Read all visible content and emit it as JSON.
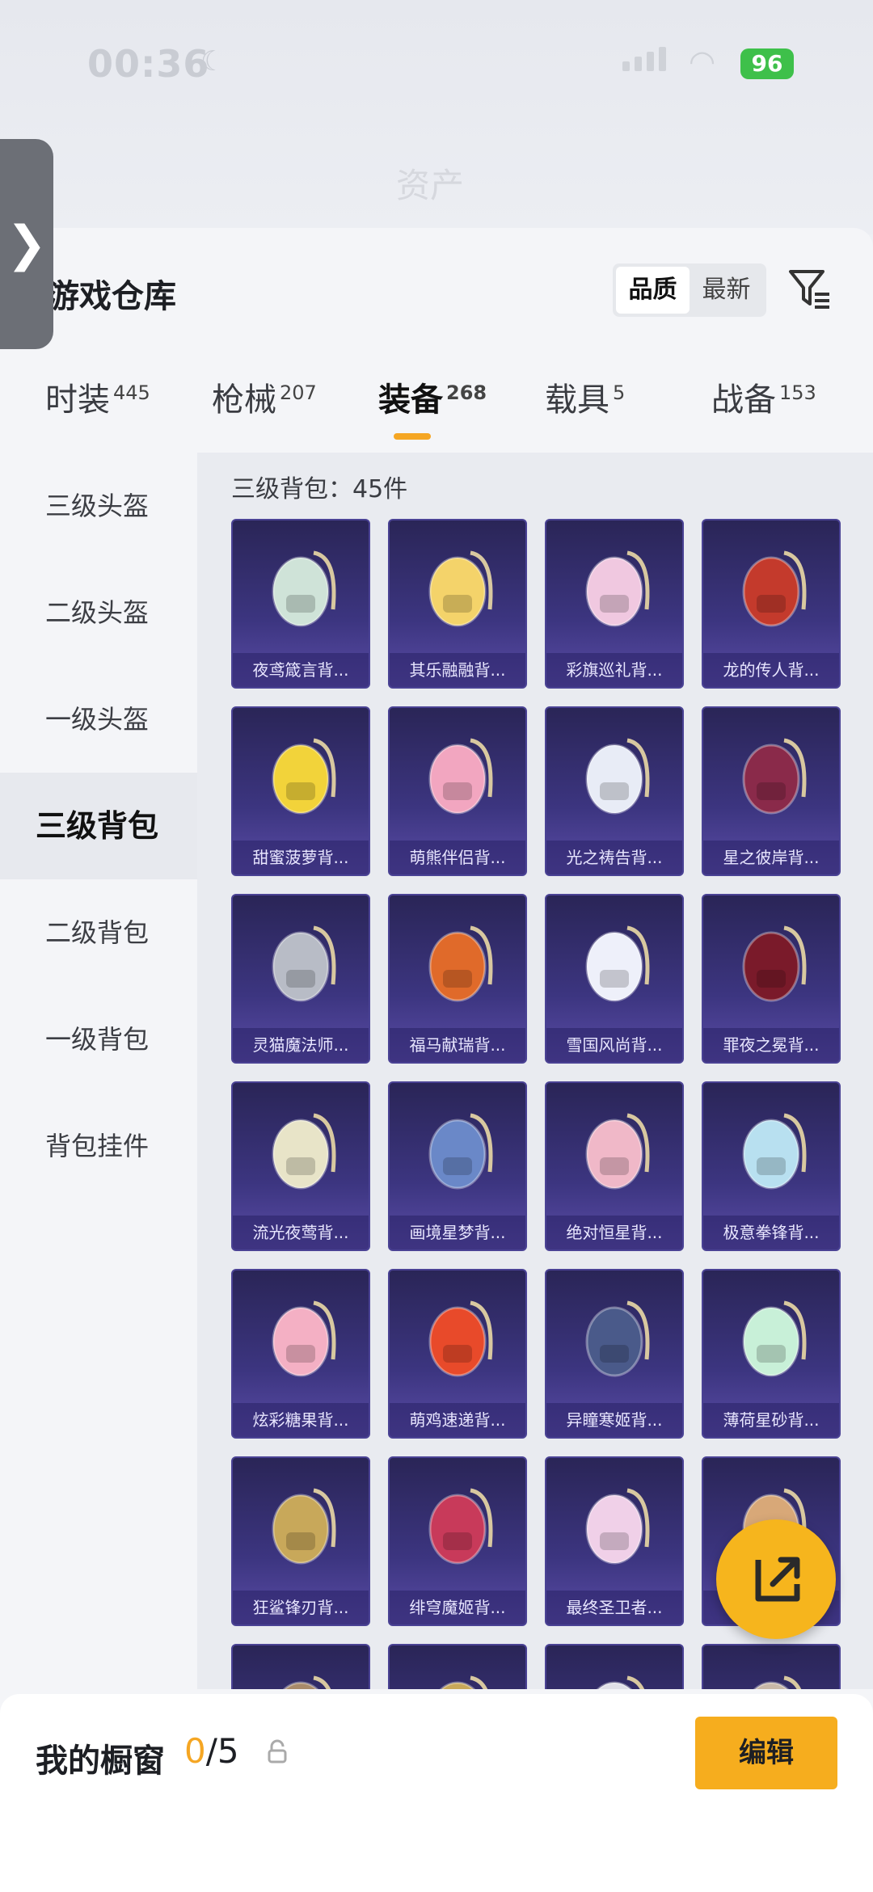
{
  "status_bar": {
    "time": "00:36",
    "battery": "96"
  },
  "header": {
    "title": "资产"
  },
  "panel": {
    "title": "游戏仓库",
    "sort_options": [
      {
        "label": "品质",
        "active": true
      },
      {
        "label": "最新",
        "active": false
      }
    ]
  },
  "tabs": [
    {
      "label": "时装",
      "count": "445",
      "active": false
    },
    {
      "label": "枪械",
      "count": "207",
      "active": false
    },
    {
      "label": "装备",
      "count": "268",
      "active": true
    },
    {
      "label": "载具",
      "count": "5",
      "active": false
    },
    {
      "label": "战备",
      "count": "153",
      "active": false
    }
  ],
  "categories": [
    {
      "label": "三级头盔",
      "active": false
    },
    {
      "label": "二级头盔",
      "active": false
    },
    {
      "label": "一级头盔",
      "active": false
    },
    {
      "label": "三级背包",
      "active": true
    },
    {
      "label": "二级背包",
      "active": false
    },
    {
      "label": "一级背包",
      "active": false
    },
    {
      "label": "背包挂件",
      "active": false
    }
  ],
  "grid": {
    "label": "三级背包：45件",
    "items": [
      {
        "name": "夜鸢箴言背...",
        "color": "#cfe3d8"
      },
      {
        "name": "其乐融融背...",
        "color": "#f4d36a"
      },
      {
        "name": "彩旗巡礼背...",
        "color": "#f0c8e0"
      },
      {
        "name": "龙的传人背...",
        "color": "#c43a2c"
      },
      {
        "name": "甜蜜菠萝背...",
        "color": "#f2d33a"
      },
      {
        "name": "萌熊伴侣背...",
        "color": "#f2a6c0"
      },
      {
        "name": "光之祷告背...",
        "color": "#e8ecf6"
      },
      {
        "name": "星之彼岸背...",
        "color": "#8a2a4a"
      },
      {
        "name": "灵猫魔法师...",
        "color": "#b8bcc6"
      },
      {
        "name": "福马献瑞背...",
        "color": "#e06a2a"
      },
      {
        "name": "雪国风尚背...",
        "color": "#eef0fa"
      },
      {
        "name": "罪夜之冕背...",
        "color": "#7a1a2a"
      },
      {
        "name": "流光夜莺背...",
        "color": "#e8e4c8"
      },
      {
        "name": "画境星梦背...",
        "color": "#6a88c8"
      },
      {
        "name": "绝对恒星背...",
        "color": "#f0b8c8"
      },
      {
        "name": "极意拳锋背...",
        "color": "#b8e0f0"
      },
      {
        "name": "炫彩糖果背...",
        "color": "#f4b0c4"
      },
      {
        "name": "萌鸡速递背...",
        "color": "#e84a2a"
      },
      {
        "name": "异瞳寒姬背...",
        "color": "#4a5a8a"
      },
      {
        "name": "薄荷星砂背...",
        "color": "#c8f0d8"
      },
      {
        "name": "狂鲨锋刃背...",
        "color": "#c8a85a"
      },
      {
        "name": "绯穹魔姬背...",
        "color": "#c83a5a"
      },
      {
        "name": "最终圣卫者...",
        "color": "#f0d0e8"
      },
      {
        "name": "",
        "color": "#d8a878"
      },
      {
        "name": "",
        "color": "#a88a6a"
      },
      {
        "name": "",
        "color": "#c8a85a"
      },
      {
        "name": "",
        "color": "#e0e0e8"
      },
      {
        "name": "",
        "color": "#c8b8a8"
      }
    ]
  },
  "bottom_bar": {
    "label": "我的橱窗",
    "used": "0",
    "total": "/5",
    "edit_label": "编辑"
  },
  "colors": {
    "accent": "#f5a623",
    "card_bg": "#3c3580"
  }
}
